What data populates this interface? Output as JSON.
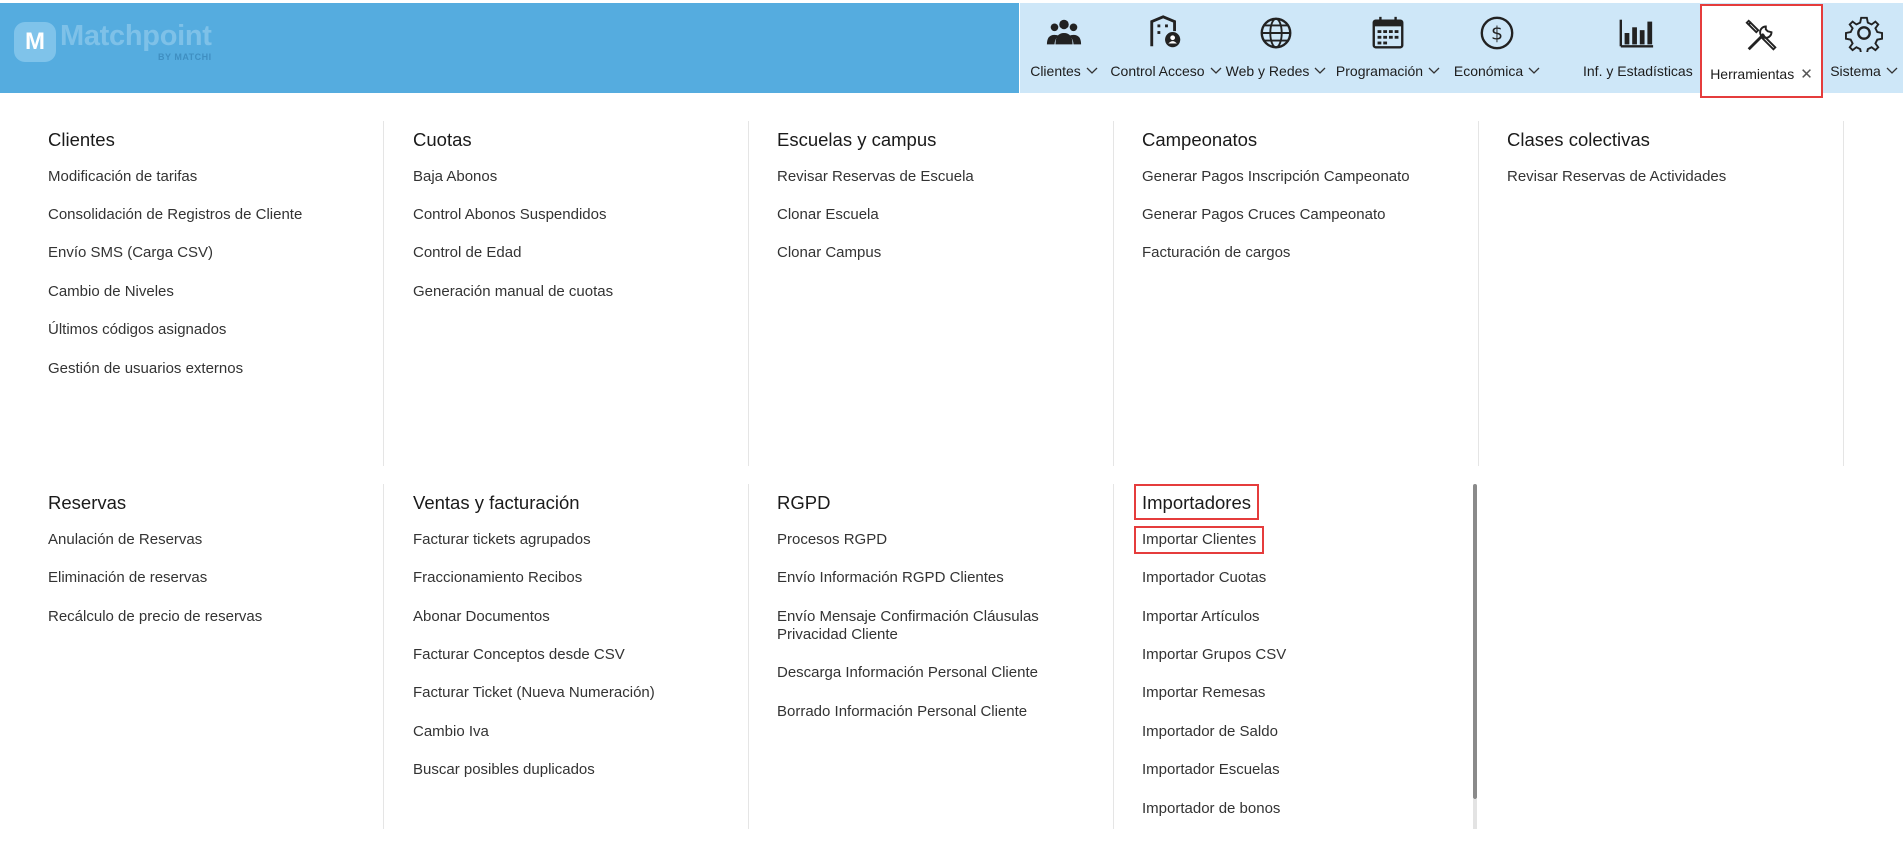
{
  "brand": {
    "badge": "M",
    "name": "Matchpoint",
    "sub": "BY MATCHI"
  },
  "nav": {
    "clientes": "Clientes",
    "control_acceso": "Control Acceso",
    "web_redes": "Web y Redes",
    "programacion": "Programación",
    "economica": "Económica",
    "estadisticas": "Inf. y Estadísticas",
    "herramientas": "Herramientas",
    "herramientas_close": "✕",
    "sistema": "Sistema"
  },
  "menu": {
    "clientes": {
      "title": "Clientes",
      "items": [
        "Modificación de tarifas",
        "Consolidación de Registros de Cliente",
        "Envío SMS (Carga CSV)",
        "Cambio de Niveles",
        "Últimos códigos asignados",
        "Gestión de usuarios externos"
      ]
    },
    "cuotas": {
      "title": "Cuotas",
      "items": [
        "Baja Abonos",
        "Control Abonos Suspendidos",
        "Control de Edad",
        "Generación manual de cuotas"
      ]
    },
    "escuelas": {
      "title": "Escuelas y campus",
      "items": [
        "Revisar Reservas de Escuela",
        "Clonar Escuela",
        "Clonar Campus"
      ]
    },
    "campeonatos": {
      "title": "Campeonatos",
      "items": [
        "Generar Pagos Inscripción Campeonato",
        "Generar Pagos Cruces Campeonato",
        "Facturación de cargos"
      ]
    },
    "clases": {
      "title": "Clases colectivas",
      "items": [
        "Revisar Reservas de Actividades"
      ]
    },
    "reservas": {
      "title": "Reservas",
      "items": [
        "Anulación de Reservas",
        "Eliminación de reservas",
        "Recálculo de precio de reservas"
      ]
    },
    "ventas": {
      "title": "Ventas y facturación",
      "items": [
        "Facturar tickets agrupados",
        "Fraccionamiento Recibos",
        "Abonar Documentos",
        "Facturar Conceptos desde CSV",
        "Facturar Ticket (Nueva Numeración)",
        "Cambio Iva",
        "Buscar posibles duplicados"
      ]
    },
    "rgpd": {
      "title": "RGPD",
      "items": [
        "Procesos RGPD",
        "Envío Información RGPD Clientes",
        "Envío Mensaje Confirmación Cláusulas Privacidad Cliente",
        "Descarga Información Personal Cliente",
        "Borrado Información Personal Cliente"
      ]
    },
    "importadores": {
      "title": "Importadores",
      "items": [
        "Importar Clientes",
        "Importador Cuotas",
        "Importar Artículos",
        "Importar Grupos CSV",
        "Importar Remesas",
        "Importador de Saldo",
        "Importador Escuelas",
        "Importador de bonos"
      ]
    }
  },
  "colors": {
    "brand_blue": "#55acdf",
    "nav_bg": "#cee7f8",
    "highlight": "#e53c3c"
  }
}
